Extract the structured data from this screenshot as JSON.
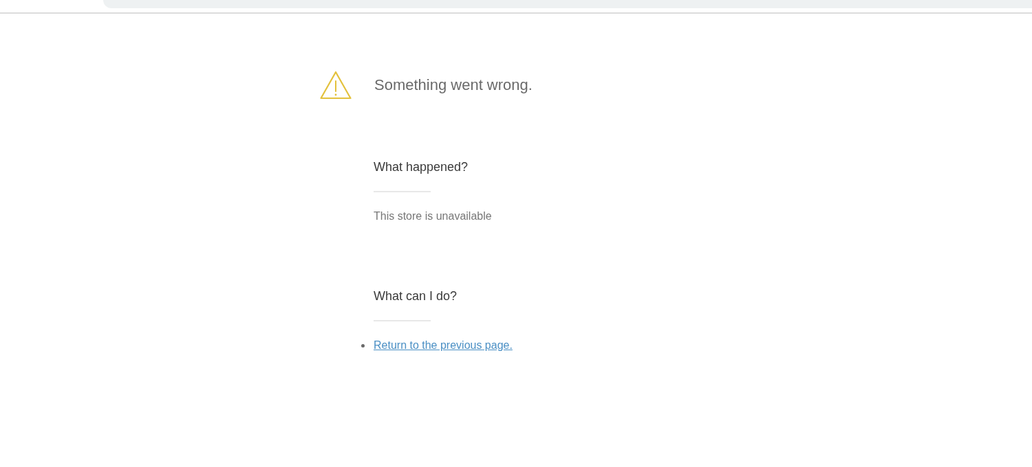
{
  "error": {
    "title": "Something went wrong."
  },
  "sections": [
    {
      "kind": "text",
      "heading": "What happened?",
      "text": "This store is unavailable"
    },
    {
      "kind": "links",
      "heading": "What can I do?",
      "links": [
        "Return to the previous page."
      ]
    }
  ]
}
